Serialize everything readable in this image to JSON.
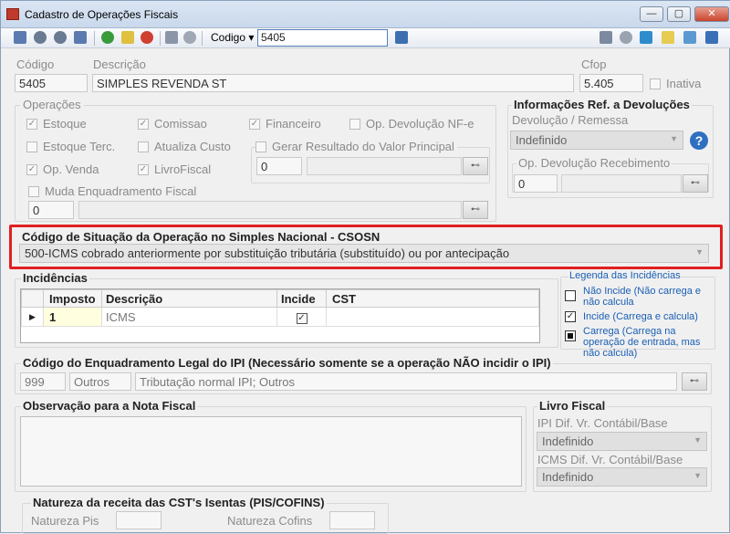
{
  "window": {
    "title": "Cadastro de Operações Fiscais"
  },
  "toolbar": {
    "search_field": "Codigo",
    "search_value": "5405"
  },
  "header": {
    "codigo_label": "Código",
    "codigo": "5405",
    "descricao_label": "Descrição",
    "descricao": "SIMPLES REVENDA ST",
    "cfop_label": "Cfop",
    "cfop": "5.405",
    "inativa_label": "Inativa"
  },
  "operacoes": {
    "title": "Operações",
    "estoque": "Estoque",
    "comissao": "Comissao",
    "financeiro": "Financeiro",
    "op_devolucao": "Op. Devolução NF-e",
    "estoque_terc": "Estoque Terc.",
    "atualiza_custo": "Atualiza Custo",
    "gerar_resultado": "Gerar Resultado do Valor Principal",
    "gerar_resultado_code": "0",
    "op_venda": "Op. Venda",
    "livro_fiscal": "LivroFiscal",
    "muda_enq": "Muda Enquadramento Fiscal",
    "muda_enq_code": "0"
  },
  "devolucoes": {
    "title": "Informações Ref. a Devoluções",
    "devolucao_remessa": "Devolução / Remessa",
    "devolucao_value": "Indefinido",
    "op_dev_receb": "Op. Devolução Recebimento",
    "op_dev_code": "0"
  },
  "csosn": {
    "title": "Código de Situação da Operação no Simples Nacional - CSOSN",
    "value": "500-ICMS cobrado anteriormente por substituição tributária (substituído) ou por antecipação"
  },
  "incidencias": {
    "title": "Incidências",
    "headers": [
      "Imposto",
      "Descrição",
      "Incide",
      "CST"
    ],
    "rows": [
      {
        "imposto": "1",
        "descricao": "ICMS",
        "incide": "✓",
        "cst": ""
      }
    ]
  },
  "legenda": {
    "title": "Legenda das Incidências",
    "nao_incide": "Não Incide (Não carrega e não calcula",
    "incide": "Incide (Carrega e calcula)",
    "carrega": "Carrega (Carrega na operação de entrada, mas não calcula)"
  },
  "ipi": {
    "title": "Código do Enquadramento Legal do IPI (Necessário somente se a operação NÃO incidir o IPI)",
    "code": "999",
    "group": "Outros",
    "description": "Tributação normal IPI; Outros"
  },
  "observacao": {
    "title": "Observação para a Nota Fiscal"
  },
  "livro_fiscal": {
    "title": "Livro Fiscal",
    "ipi_label": "IPI Dif. Vr. Contábil/Base",
    "ipi_value": "Indefinido",
    "icms_label": "ICMS Dif. Vr. Contábil/Base",
    "icms_value": "Indefinido"
  },
  "natureza": {
    "title": "Natureza da receita das CST's Isentas (PIS/COFINS)",
    "pis": "Natureza Pis",
    "cofins": "Natureza Cofins"
  },
  "colors": {
    "highlight": "#e02020",
    "accent": "#1a5fb4"
  }
}
